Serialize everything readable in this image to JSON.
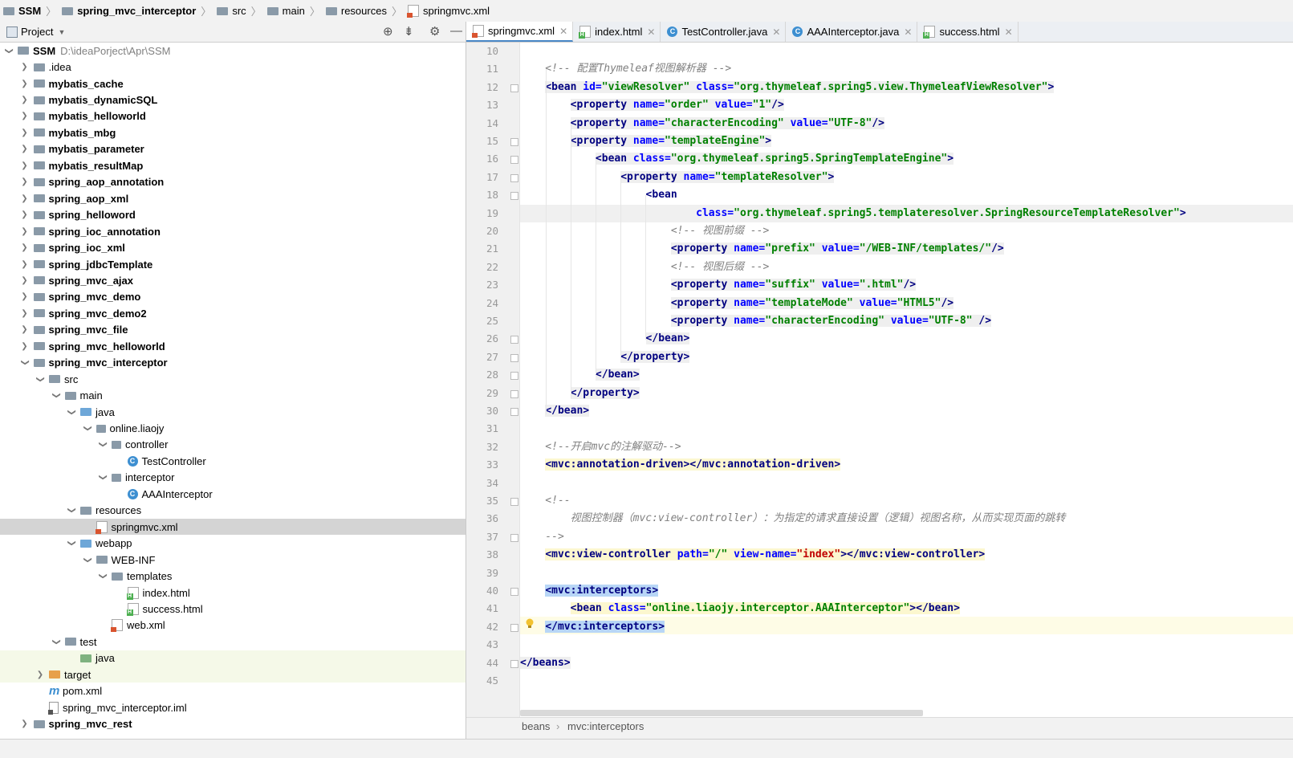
{
  "breadcrumb": [
    "SSM",
    "spring_mvc_interceptor",
    "src",
    "main",
    "resources",
    "springmvc.xml"
  ],
  "project_panel": {
    "title": "Project"
  },
  "tree": [
    {
      "label": "SSM",
      "path": "D:\\ideaPorject\\Apr\\SSM",
      "depth": 0,
      "arrow": "down",
      "bold": true,
      "icon": "module"
    },
    {
      "label": ".idea",
      "depth": 1,
      "arrow": "right",
      "icon": "folder"
    },
    {
      "label": "mybatis_cache",
      "depth": 1,
      "arrow": "right",
      "bold": true,
      "icon": "module"
    },
    {
      "label": "mybatis_dynamicSQL",
      "depth": 1,
      "arrow": "right",
      "bold": true,
      "icon": "module"
    },
    {
      "label": "mybatis_helloworld",
      "depth": 1,
      "arrow": "right",
      "bold": true,
      "icon": "module"
    },
    {
      "label": "mybatis_mbg",
      "depth": 1,
      "arrow": "right",
      "bold": true,
      "icon": "module"
    },
    {
      "label": "mybatis_parameter",
      "depth": 1,
      "arrow": "right",
      "bold": true,
      "icon": "module"
    },
    {
      "label": "mybatis_resultMap",
      "depth": 1,
      "arrow": "right",
      "bold": true,
      "icon": "module"
    },
    {
      "label": "spring_aop_annotation",
      "depth": 1,
      "arrow": "right",
      "bold": true,
      "icon": "module"
    },
    {
      "label": "spring_aop_xml",
      "depth": 1,
      "arrow": "right",
      "bold": true,
      "icon": "module"
    },
    {
      "label": "spring_helloword",
      "depth": 1,
      "arrow": "right",
      "bold": true,
      "icon": "module"
    },
    {
      "label": "spring_ioc_annotation",
      "depth": 1,
      "arrow": "right",
      "bold": true,
      "icon": "module"
    },
    {
      "label": "spring_ioc_xml",
      "depth": 1,
      "arrow": "right",
      "bold": true,
      "icon": "module"
    },
    {
      "label": "spring_jdbcTemplate",
      "depth": 1,
      "arrow": "right",
      "bold": true,
      "icon": "module"
    },
    {
      "label": "spring_mvc_ajax",
      "depth": 1,
      "arrow": "right",
      "bold": true,
      "icon": "module"
    },
    {
      "label": "spring_mvc_demo",
      "depth": 1,
      "arrow": "right",
      "bold": true,
      "icon": "module"
    },
    {
      "label": "spring_mvc_demo2",
      "depth": 1,
      "arrow": "right",
      "bold": true,
      "icon": "module"
    },
    {
      "label": "spring_mvc_file",
      "depth": 1,
      "arrow": "right",
      "bold": true,
      "icon": "module"
    },
    {
      "label": "spring_mvc_helloworld",
      "depth": 1,
      "arrow": "right",
      "bold": true,
      "icon": "module"
    },
    {
      "label": "spring_mvc_interceptor",
      "depth": 1,
      "arrow": "down",
      "bold": true,
      "icon": "module"
    },
    {
      "label": "src",
      "depth": 2,
      "arrow": "down",
      "icon": "folder"
    },
    {
      "label": "main",
      "depth": 3,
      "arrow": "down",
      "icon": "folder"
    },
    {
      "label": "java",
      "depth": 4,
      "arrow": "down",
      "icon": "folder-blue"
    },
    {
      "label": "online.liaojy",
      "depth": 5,
      "arrow": "down",
      "icon": "package"
    },
    {
      "label": "controller",
      "depth": 6,
      "arrow": "down",
      "icon": "package"
    },
    {
      "label": "TestController",
      "depth": 7,
      "arrow": "",
      "icon": "class"
    },
    {
      "label": "interceptor",
      "depth": 6,
      "arrow": "down",
      "icon": "package"
    },
    {
      "label": "AAAInterceptor",
      "depth": 7,
      "arrow": "",
      "icon": "class"
    },
    {
      "label": "resources",
      "depth": 4,
      "arrow": "down",
      "icon": "folder-res"
    },
    {
      "label": "springmvc.xml",
      "depth": 5,
      "arrow": "",
      "icon": "xml",
      "selected": true
    },
    {
      "label": "webapp",
      "depth": 4,
      "arrow": "down",
      "icon": "folder-web"
    },
    {
      "label": "WEB-INF",
      "depth": 5,
      "arrow": "down",
      "icon": "folder"
    },
    {
      "label": "templates",
      "depth": 6,
      "arrow": "down",
      "icon": "folder"
    },
    {
      "label": "index.html",
      "depth": 7,
      "arrow": "",
      "icon": "html"
    },
    {
      "label": "success.html",
      "depth": 7,
      "arrow": "",
      "icon": "html"
    },
    {
      "label": "web.xml",
      "depth": 6,
      "arrow": "",
      "icon": "xml"
    },
    {
      "label": "test",
      "depth": 3,
      "arrow": "down",
      "icon": "folder"
    },
    {
      "label": "java",
      "depth": 4,
      "arrow": "",
      "icon": "folder-green",
      "highlight": true
    },
    {
      "label": "target",
      "depth": 2,
      "arrow": "right",
      "icon": "folder-orange",
      "highlight": true
    },
    {
      "label": "pom.xml",
      "depth": 2,
      "arrow": "",
      "icon": "maven"
    },
    {
      "label": "spring_mvc_interceptor.iml",
      "depth": 2,
      "arrow": "",
      "icon": "iml"
    },
    {
      "label": "spring_mvc_rest",
      "depth": 1,
      "arrow": "right",
      "bold": true,
      "icon": "module"
    }
  ],
  "tabs": [
    {
      "label": "springmvc.xml",
      "icon": "xml",
      "active": true
    },
    {
      "label": "index.html",
      "icon": "html"
    },
    {
      "label": "TestController.java",
      "icon": "class"
    },
    {
      "label": "AAAInterceptor.java",
      "icon": "class"
    },
    {
      "label": "success.html",
      "icon": "html"
    }
  ],
  "editor": {
    "line_numbers": [
      "10",
      "11",
      "12",
      "13",
      "14",
      "15",
      "16",
      "17",
      "18",
      "19",
      "20",
      "21",
      "22",
      "23",
      "24",
      "25",
      "26",
      "27",
      "28",
      "29",
      "30",
      "31",
      "32",
      "33",
      "34",
      "35",
      "36",
      "37",
      "38",
      "39",
      "40",
      "41",
      "42",
      "43",
      "44",
      "45"
    ],
    "lines": [
      "",
      "<span class='cm'>    &lt;!-- 配置Thymeleaf视图解析器 --&gt;</span>",
      "    <span class='tg hl-tag'>&lt;bean <span class='at'>id=</span><span class='av'>\"viewResolver\"</span> <span class='at'>class=</span><span class='av'>\"org.thymeleaf.spring5.view.ThymeleafViewResolver\"</span>&gt;</span>",
      "        <span class='tg hl-tag'>&lt;property <span class='at'>name=</span><span class='av'>\"order\"</span> <span class='at'>value=</span><span class='av'>\"1\"</span>/&gt;</span>",
      "        <span class='tg hl-tag'>&lt;property <span class='at'>name=</span><span class='av'>\"characterEncoding\"</span> <span class='at'>value=</span><span class='av'>\"UTF-8\"</span>/&gt;</span>",
      "        <span class='tg hl-tag'>&lt;property <span class='at'>name=</span><span class='av'>\"templateEngine\"</span>&gt;</span>",
      "            <span class='tg hl-tag'>&lt;bean <span class='at'>class=</span><span class='av'>\"org.thymeleaf.spring5.SpringTemplateEngine\"</span>&gt;</span>",
      "                <span class='tg hl-tag'>&lt;property <span class='at'>name=</span><span class='av'>\"templateResolver\"</span>&gt;</span>",
      "                    <span class='tg'>&lt;bean</span>",
      "                            <span class='at'>class=</span><span class='av'>\"org.thymeleaf.spring5.templateresolver.SpringResourceTemplateResolver\"</span><span class='tg'>&gt;</span>",
      "<span class='cm'>                        &lt;!-- 视图前缀 --&gt;</span>",
      "                        <span class='tg hl-tag'>&lt;property <span class='at'>name=</span><span class='av'>\"prefix\"</span> <span class='at'>value=</span><span class='av'>\"/WEB-INF/templates/\"</span>/&gt;</span>",
      "<span class='cm'>                        &lt;!-- 视图后缀 --&gt;</span>",
      "                        <span class='tg hl-tag'>&lt;property <span class='at'>name=</span><span class='av'>\"suffix\"</span> <span class='at'>value=</span><span class='av'>\".html\"</span>/&gt;</span>",
      "                        <span class='tg hl-tag'>&lt;property <span class='at'>name=</span><span class='av'>\"templateMode\"</span> <span class='at'>value=</span><span class='av'>\"HTML5\"</span>/&gt;</span>",
      "                        <span class='tg hl-tag'>&lt;property <span class='at'>name=</span><span class='av'>\"characterEncoding\"</span> <span class='at'>value=</span><span class='av'>\"UTF-8\"</span> /&gt;</span>",
      "                    <span class='tg hl-tag'>&lt;/bean&gt;</span>",
      "                <span class='tg hl-tag'>&lt;/property&gt;</span>",
      "            <span class='tg hl-tag'>&lt;/bean&gt;</span>",
      "        <span class='tg hl-tag'>&lt;/property&gt;</span>",
      "    <span class='tg hl-tag'>&lt;/bean&gt;</span>",
      "",
      "<span class='cm'>    &lt;!--开启mvc的注解驱动--&gt;</span>",
      "    <span class='tg yellow'>&lt;mvc:annotation-driven&gt;&lt;/mvc:annotation-driven&gt;</span>",
      "",
      "<span class='cm'>    &lt;!--</span>",
      "<span class='cm'>        视图控制器（mvc:view-controller）：为指定的请求直接设置（逻辑）视图名称，从而实现页面的跳转</span>",
      "<span class='cm'>    --&gt;</span>",
      "    <span class='tg yellow'>&lt;mvc:view-controller <span class='at'>path=</span><span class='av'>\"/\"</span> <span class='at'>view-name=</span><span class='red'>\"index\"</span>&gt;&lt;/mvc:view-controller&gt;</span>",
      "",
      "    <span class='tg blue'>&lt;mvc:interceptors&gt;</span>",
      "        <span class='tg yellow'>&lt;bean <span class='at'>class=</span><span class='av'>\"online.liaojy.interceptor.AAAInterceptor\"</span>&gt;&lt;/bean&gt;</span>",
      "    <span class='tg blue'>&lt;/mvc:interceptors&gt;</span>",
      "",
      "<span class='tg hl-tag'>&lt;/beans&gt;</span>",
      ""
    ]
  },
  "status_breadcrumb": [
    "beans",
    "mvc:interceptors"
  ]
}
